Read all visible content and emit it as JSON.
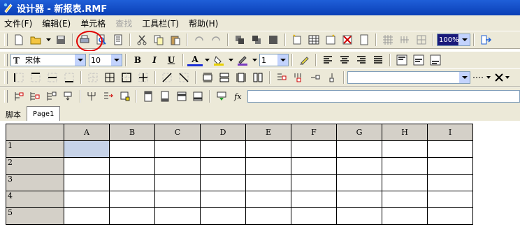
{
  "window": {
    "title": "设计器 - 新报表.RMF"
  },
  "menu": [
    {
      "label": "文件(F)",
      "enabled": true
    },
    {
      "label": "编辑(E)",
      "enabled": true
    },
    {
      "label": "单元格",
      "enabled": true
    },
    {
      "label": "查找",
      "enabled": false
    },
    {
      "label": "工具栏(T)",
      "enabled": true
    },
    {
      "label": "帮助(H)",
      "enabled": true
    }
  ],
  "toolbar": {
    "zoom": "100%",
    "font_family": "宋体",
    "font_size": "10",
    "bold": "B",
    "italic": "I",
    "underline": "U",
    "font_color": "A",
    "line_width": "1",
    "fx": "fx",
    "formula_value": ""
  },
  "tabs": [
    "脚本",
    "Page1"
  ],
  "grid": {
    "columns": [
      "A",
      "B",
      "C",
      "D",
      "E",
      "F",
      "G",
      "H",
      "I"
    ],
    "rows": [
      "1",
      "2",
      "3",
      "4",
      "5"
    ],
    "selected_cell": "A1"
  },
  "colors": {
    "title_bar": "#0a3fb6",
    "annotation": "#e00000",
    "selection": "#c7d3e8"
  }
}
